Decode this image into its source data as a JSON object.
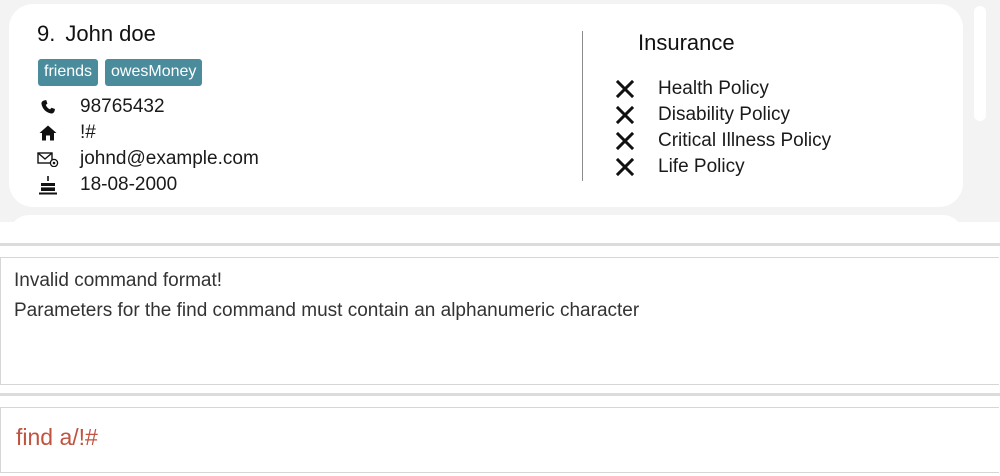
{
  "person": {
    "index": "9.",
    "name": "John doe",
    "tags": [
      "friends",
      "owesMoney"
    ],
    "phone": "98765432",
    "address": "!#",
    "email": "johnd@example.com",
    "birthday": "18-08-2000",
    "icons": {
      "phone": "phone-icon",
      "address": "home-icon",
      "email": "email-icon",
      "birthday": "birthday-cake-icon"
    }
  },
  "insurance": {
    "title": "Insurance",
    "policies": [
      {
        "label": "Health Policy",
        "status": "not-covered",
        "icon": "cross-icon"
      },
      {
        "label": "Disability Policy",
        "status": "not-covered",
        "icon": "cross-icon"
      },
      {
        "label": "Critical Illness Policy",
        "status": "not-covered",
        "icon": "cross-icon"
      },
      {
        "label": "Life Policy",
        "status": "not-covered",
        "icon": "cross-icon"
      }
    ]
  },
  "result": {
    "lines": [
      "Invalid command format!",
      "Parameters for the find command must contain an alphanumeric character"
    ]
  },
  "command": {
    "value": "find a/!#",
    "text_color": "#c0533f"
  },
  "colors": {
    "tag_bg": "#4a8c9c",
    "list_bg": "#f3f3f3",
    "error_text": "#c0533f"
  }
}
